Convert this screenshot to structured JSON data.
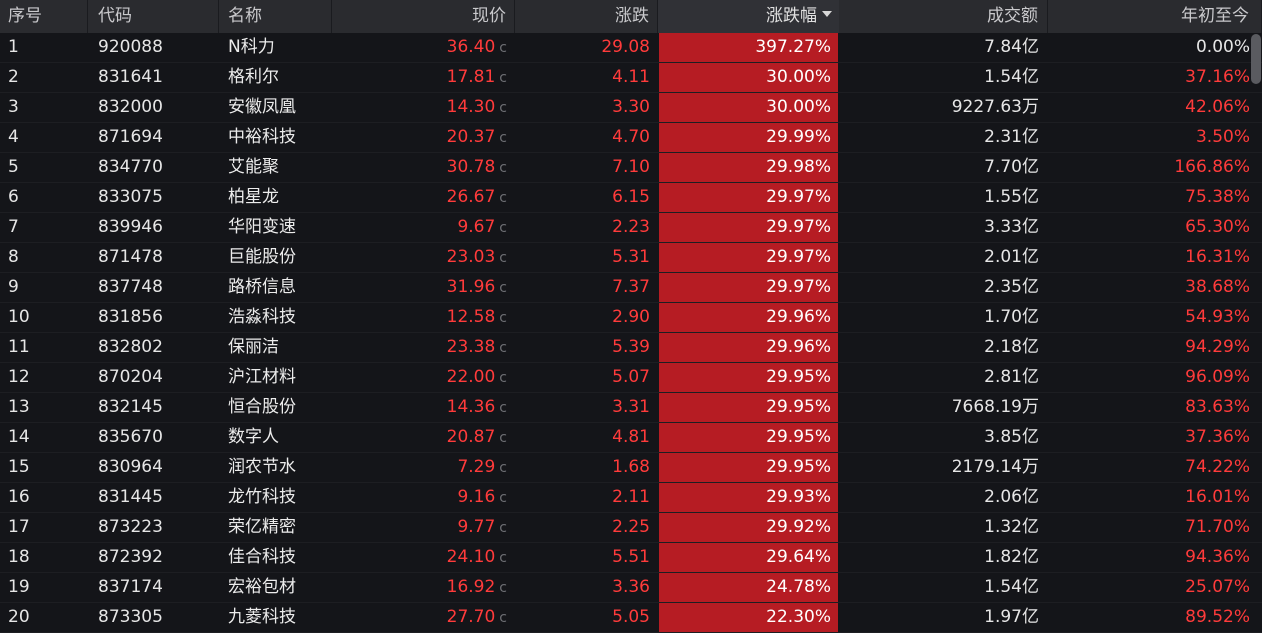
{
  "columns": {
    "seq": "序号",
    "code": "代码",
    "name": "名称",
    "price": "现价",
    "change": "涨跌",
    "pct": "涨跌幅",
    "volume": "成交额",
    "ytd": "年初至今"
  },
  "price_flag": "c",
  "colors": {
    "up": "#ff3b3b",
    "pct_bg": "#b61c23",
    "background": "#141519",
    "header_bg": "#2a2b2f"
  },
  "rows": [
    {
      "seq": "1",
      "code": "920088",
      "name": "N科力",
      "price": "36.40",
      "change": "29.08",
      "pct": "397.27%",
      "volume": "7.84亿",
      "ytd": "0.00%"
    },
    {
      "seq": "2",
      "code": "831641",
      "name": "格利尔",
      "price": "17.81",
      "change": "4.11",
      "pct": "30.00%",
      "volume": "1.54亿",
      "ytd": "37.16%"
    },
    {
      "seq": "3",
      "code": "832000",
      "name": "安徽凤凰",
      "price": "14.30",
      "change": "3.30",
      "pct": "30.00%",
      "volume": "9227.63万",
      "ytd": "42.06%"
    },
    {
      "seq": "4",
      "code": "871694",
      "name": "中裕科技",
      "price": "20.37",
      "change": "4.70",
      "pct": "29.99%",
      "volume": "2.31亿",
      "ytd": "3.50%"
    },
    {
      "seq": "5",
      "code": "834770",
      "name": "艾能聚",
      "price": "30.78",
      "change": "7.10",
      "pct": "29.98%",
      "volume": "7.70亿",
      "ytd": "166.86%"
    },
    {
      "seq": "6",
      "code": "833075",
      "name": "柏星龙",
      "price": "26.67",
      "change": "6.15",
      "pct": "29.97%",
      "volume": "1.55亿",
      "ytd": "75.38%"
    },
    {
      "seq": "7",
      "code": "839946",
      "name": "华阳变速",
      "price": "9.67",
      "change": "2.23",
      "pct": "29.97%",
      "volume": "3.33亿",
      "ytd": "65.30%"
    },
    {
      "seq": "8",
      "code": "871478",
      "name": "巨能股份",
      "price": "23.03",
      "change": "5.31",
      "pct": "29.97%",
      "volume": "2.01亿",
      "ytd": "16.31%"
    },
    {
      "seq": "9",
      "code": "837748",
      "name": "路桥信息",
      "price": "31.96",
      "change": "7.37",
      "pct": "29.97%",
      "volume": "2.35亿",
      "ytd": "38.68%"
    },
    {
      "seq": "10",
      "code": "831856",
      "name": "浩淼科技",
      "price": "12.58",
      "change": "2.90",
      "pct": "29.96%",
      "volume": "1.70亿",
      "ytd": "54.93%"
    },
    {
      "seq": "11",
      "code": "832802",
      "name": "保丽洁",
      "price": "23.38",
      "change": "5.39",
      "pct": "29.96%",
      "volume": "2.18亿",
      "ytd": "94.29%"
    },
    {
      "seq": "12",
      "code": "870204",
      "name": "沪江材料",
      "price": "22.00",
      "change": "5.07",
      "pct": "29.95%",
      "volume": "2.81亿",
      "ytd": "96.09%"
    },
    {
      "seq": "13",
      "code": "832145",
      "name": "恒合股份",
      "price": "14.36",
      "change": "3.31",
      "pct": "29.95%",
      "volume": "7668.19万",
      "ytd": "83.63%"
    },
    {
      "seq": "14",
      "code": "835670",
      "name": "数字人",
      "price": "20.87",
      "change": "4.81",
      "pct": "29.95%",
      "volume": "3.85亿",
      "ytd": "37.36%"
    },
    {
      "seq": "15",
      "code": "830964",
      "name": "润农节水",
      "price": "7.29",
      "change": "1.68",
      "pct": "29.95%",
      "volume": "2179.14万",
      "ytd": "74.22%"
    },
    {
      "seq": "16",
      "code": "831445",
      "name": "龙竹科技",
      "price": "9.16",
      "change": "2.11",
      "pct": "29.93%",
      "volume": "2.06亿",
      "ytd": "16.01%"
    },
    {
      "seq": "17",
      "code": "873223",
      "name": "荣亿精密",
      "price": "9.77",
      "change": "2.25",
      "pct": "29.92%",
      "volume": "1.32亿",
      "ytd": "71.70%"
    },
    {
      "seq": "18",
      "code": "872392",
      "name": "佳合科技",
      "price": "24.10",
      "change": "5.51",
      "pct": "29.64%",
      "volume": "1.82亿",
      "ytd": "94.36%"
    },
    {
      "seq": "19",
      "code": "837174",
      "name": "宏裕包材",
      "price": "16.92",
      "change": "3.36",
      "pct": "24.78%",
      "volume": "1.54亿",
      "ytd": "25.07%"
    },
    {
      "seq": "20",
      "code": "873305",
      "name": "九菱科技",
      "price": "27.70",
      "change": "5.05",
      "pct": "22.30%",
      "volume": "1.97亿",
      "ytd": "89.52%"
    }
  ]
}
